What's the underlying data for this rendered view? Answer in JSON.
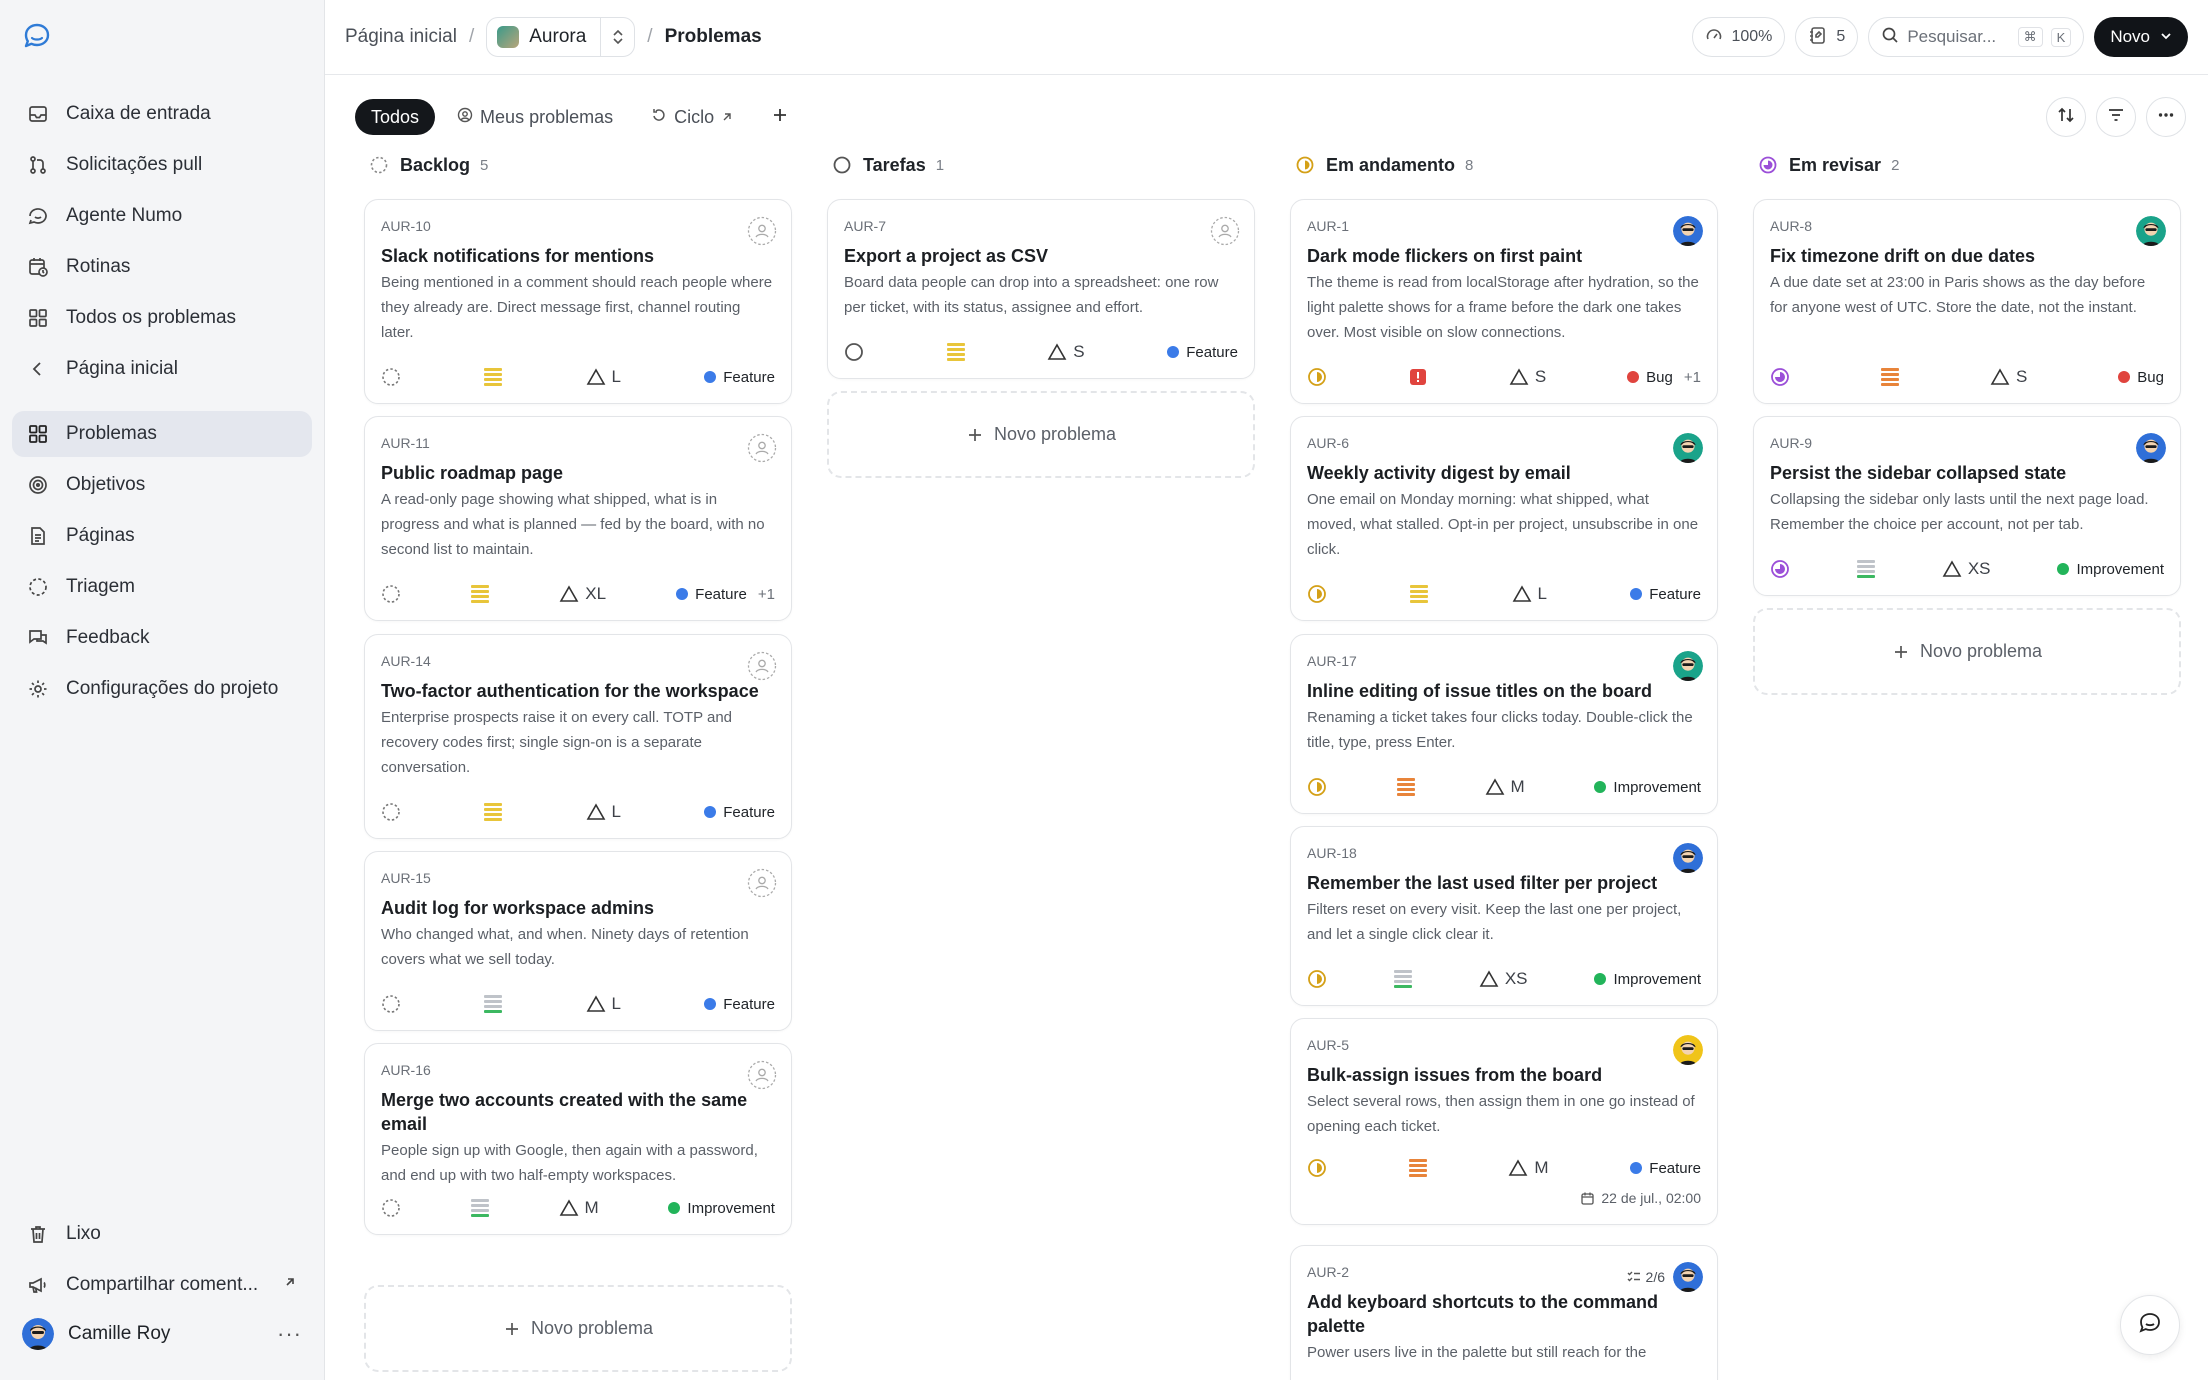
{
  "sidebar": {
    "items": [
      {
        "label": "Caixa de entrada"
      },
      {
        "label": "Solicitações pull"
      },
      {
        "label": "Agente Numo"
      },
      {
        "label": "Rotinas"
      },
      {
        "label": "Todos os problemas"
      },
      {
        "label": "Página inicial"
      },
      {
        "label": "Problemas"
      },
      {
        "label": "Objetivos"
      },
      {
        "label": "Páginas"
      },
      {
        "label": "Triagem"
      },
      {
        "label": "Feedback"
      },
      {
        "label": "Configurações do projeto"
      }
    ],
    "bottom": {
      "trash": "Lixo",
      "share": "Compartilhar coment..."
    },
    "user": {
      "name": "Camille Roy"
    }
  },
  "header": {
    "home": "Página inicial",
    "project": "Aurora",
    "current": "Problemas",
    "zoom": "100%",
    "notes_count": "5",
    "search_placeholder": "Pesquisar...",
    "kbd_cmd": "⌘",
    "kbd_k": "K",
    "new_label": "Novo"
  },
  "toolbar": {
    "tabs": [
      {
        "label": "Todos"
      },
      {
        "label": "Meus problemas"
      },
      {
        "label": "Ciclo"
      }
    ]
  },
  "board": {
    "new_issue_label": "Novo problema",
    "columns": [
      {
        "name": "Backlog",
        "count": "5",
        "cards": [
          {
            "id": "AUR-10",
            "title": "Slack notifications for mentions",
            "desc": "Being mentioned in a comment should reach people where they already are. Direct message first, channel routing later.",
            "size": "L",
            "tag": "Feature",
            "tag_extra": ""
          },
          {
            "id": "AUR-11",
            "title": "Public roadmap page",
            "desc": "A read-only page showing what shipped, what is in progress and what is planned — fed by the board, with no second list to maintain.",
            "size": "XL",
            "tag": "Feature",
            "tag_extra": "+1"
          },
          {
            "id": "AUR-14",
            "title": "Two-factor authentication for the workspace",
            "desc": "Enterprise prospects raise it on every call. TOTP and recovery codes first; single sign-on is a separate conversation.",
            "size": "L",
            "tag": "Feature",
            "tag_extra": ""
          },
          {
            "id": "AUR-15",
            "title": "Audit log for workspace admins",
            "desc": "Who changed what, and when. Ninety days of retention covers what we sell today.",
            "size": "L",
            "tag": "Feature",
            "tag_extra": ""
          },
          {
            "id": "AUR-16",
            "title": "Merge two accounts created with the same email",
            "desc": "People sign up with Google, then again with a password, and end up with two half-empty workspaces.",
            "size": "M",
            "tag": "Improvement",
            "tag_extra": ""
          }
        ]
      },
      {
        "name": "Tarefas",
        "count": "1",
        "cards": [
          {
            "id": "AUR-7",
            "title": "Export a project as CSV",
            "desc": "Board data people can drop into a spreadsheet: one row per ticket, with its status, assignee and effort.",
            "size": "S",
            "tag": "Feature",
            "tag_extra": ""
          }
        ]
      },
      {
        "name": "Em andamento",
        "count": "8",
        "cards": [
          {
            "id": "AUR-1",
            "title": "Dark mode flickers on first paint",
            "desc": "The theme is read from localStorage after hydration, so the light palette shows for a frame before the dark one takes over. Most visible on slow connections.",
            "size": "S",
            "tag": "Bug",
            "tag_extra": "+1"
          },
          {
            "id": "AUR-6",
            "title": "Weekly activity digest by email",
            "desc": "One email on Monday morning: what shipped, what moved, what stalled. Opt-in per project, unsubscribe in one click.",
            "size": "L",
            "tag": "Feature",
            "tag_extra": ""
          },
          {
            "id": "AUR-17",
            "title": "Inline editing of issue titles on the board",
            "desc": "Renaming a ticket takes four clicks today. Double-click the title, type, press Enter.",
            "size": "M",
            "tag": "Improvement",
            "tag_extra": ""
          },
          {
            "id": "AUR-18",
            "title": "Remember the last used filter per project",
            "desc": "Filters reset on every visit. Keep the last one per project, and let a single click clear it.",
            "size": "XS",
            "tag": "Improvement",
            "tag_extra": ""
          },
          {
            "id": "AUR-5",
            "title": "Bulk-assign issues from the board",
            "desc": "Select several rows, then assign them in one go instead of opening each ticket.",
            "size": "M",
            "tag": "Feature",
            "tag_extra": "",
            "due": "22 de jul., 02:00"
          },
          {
            "id": "AUR-2",
            "title": "Add keyboard shortcuts to the command palette",
            "desc": "Power users live in the palette but still reach for the",
            "checklist": "2/6"
          }
        ]
      },
      {
        "name": "Em revisar",
        "count": "2",
        "cards": [
          {
            "id": "AUR-8",
            "title": "Fix timezone drift on due dates",
            "desc": "A due date set at 23:00 in Paris shows as the day before for anyone west of UTC. Store the date, not the instant.",
            "size": "S",
            "tag": "Bug",
            "tag_extra": ""
          },
          {
            "id": "AUR-9",
            "title": "Persist the sidebar collapsed state",
            "desc": "Collapsing the sidebar only lasts until the next page load. Remember the choice per account, not per tab.",
            "size": "XS",
            "tag": "Improvement",
            "tag_extra": ""
          }
        ]
      }
    ]
  },
  "colors": {
    "feature": "#3b7be8",
    "improvement": "#22b45a",
    "bug": "#e0443e",
    "in_progress": "#d4a017",
    "review": "#9b4fd8",
    "accent_dark": "#111418"
  }
}
